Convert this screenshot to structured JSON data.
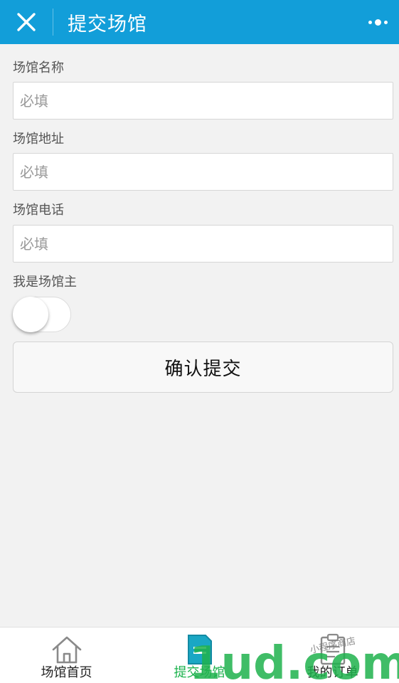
{
  "header": {
    "title": "提交场馆",
    "close_icon": "close-icon",
    "more_icon": "more-dots-icon",
    "bg_color": "#129ed9"
  },
  "form": {
    "fields": [
      {
        "label": "场馆名称",
        "placeholder": "必填",
        "value": ""
      },
      {
        "label": "场馆地址",
        "placeholder": "必填",
        "value": ""
      },
      {
        "label": "场馆电话",
        "placeholder": "必填",
        "value": ""
      }
    ],
    "owner_label": "我是场馆主",
    "owner_toggle_on": false,
    "submit_label": "确认提交"
  },
  "tabbar": {
    "active_color": "#19b24b",
    "items": [
      {
        "label": "场馆首页",
        "icon": "home-icon",
        "active": false
      },
      {
        "label": "提交场馆",
        "icon": "document-icon",
        "active": true
      },
      {
        "label": "我的订单",
        "icon": "clipboard-icon",
        "active": false
      }
    ]
  },
  "watermark": {
    "text": "1ud.com",
    "subtext": "小程序商店"
  }
}
